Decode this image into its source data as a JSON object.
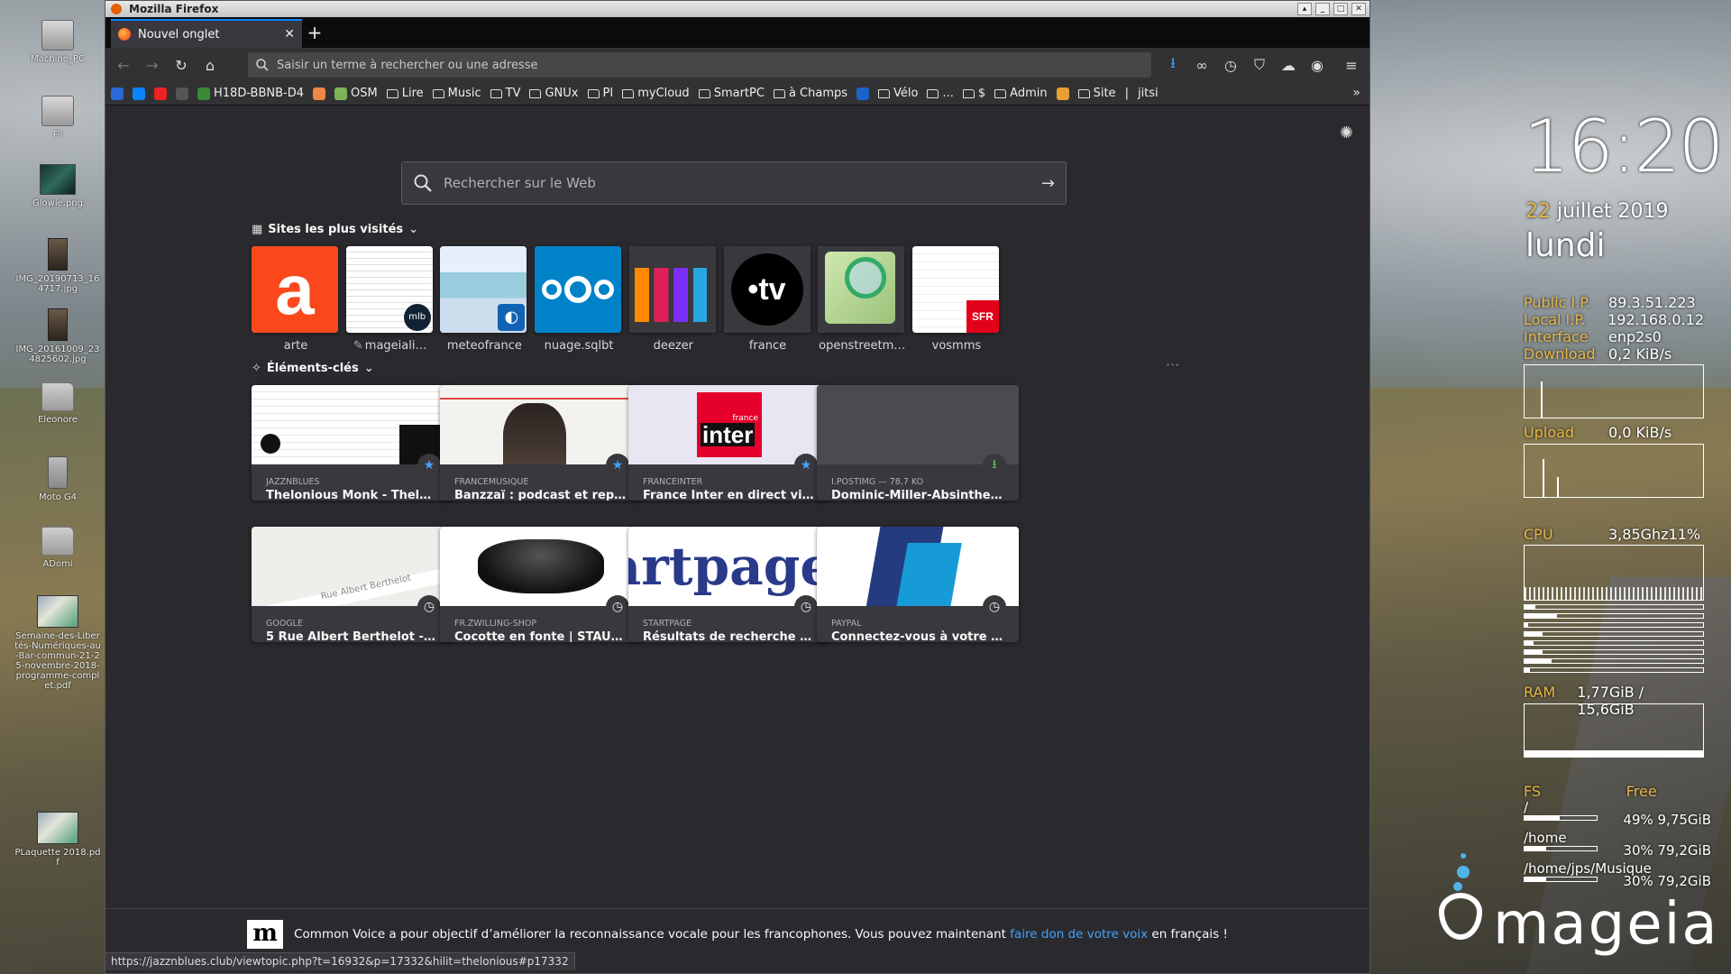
{
  "desktop": {
    "icons": [
      {
        "label": "Machine_PC",
        "kind": "drive"
      },
      {
        "label": "Fil",
        "kind": "drive"
      },
      {
        "label": "Glowie.png",
        "kind": "img"
      },
      {
        "label": "IMG_20190713_164717.jpg",
        "kind": "photo"
      },
      {
        "label": "IMG_20161009_234825602.jpg",
        "kind": "photo"
      },
      {
        "label": "Eleonore",
        "kind": "folder"
      },
      {
        "label": "Moto G4",
        "kind": "phone"
      },
      {
        "label": "ADomi",
        "kind": "folder"
      },
      {
        "label": "Semaine-des-Libertés-Numériques-au-Bar-commun-21-25-novembre-2018-programme-complet.pdf",
        "kind": "pdf"
      },
      {
        "label": "PLaquette 2018.pdf",
        "kind": "pdf"
      }
    ]
  },
  "window": {
    "title": "Mozilla Firefox"
  },
  "tabs": [
    {
      "label": "Nouvel onglet",
      "close": "✕"
    }
  ],
  "newtab_label": "+",
  "navbar": {
    "url_placeholder": "Saisir un terme à rechercher ou une adresse"
  },
  "bookmarks": [
    {
      "label": "",
      "kind": "fav",
      "color": "#2a6ad8"
    },
    {
      "label": "",
      "kind": "fav",
      "color": "#0a84ff"
    },
    {
      "label": "",
      "kind": "fav",
      "color": "#e22"
    },
    {
      "label": "",
      "kind": "fav",
      "color": "#555"
    },
    {
      "label": "H18D-BBNB-D4",
      "kind": "fav",
      "color": "#3a8a3a"
    },
    {
      "label": "",
      "kind": "fav",
      "color": "#e84"
    },
    {
      "label": "OSM",
      "kind": "fav",
      "color": "#7eb35a"
    },
    {
      "label": "Lire",
      "kind": "folder"
    },
    {
      "label": "Music",
      "kind": "folder"
    },
    {
      "label": "TV",
      "kind": "folder"
    },
    {
      "label": "GNUx",
      "kind": "folder"
    },
    {
      "label": "PI",
      "kind": "folder"
    },
    {
      "label": "myCloud",
      "kind": "folder"
    },
    {
      "label": "SmartPC",
      "kind": "folder"
    },
    {
      "label": "à Champs",
      "kind": "folder"
    },
    {
      "label": "",
      "kind": "fav",
      "color": "#1a64c8"
    },
    {
      "label": "Vélo",
      "kind": "folder"
    },
    {
      "label": "...",
      "kind": "folder"
    },
    {
      "label": "$",
      "kind": "folder"
    },
    {
      "label": "Admin",
      "kind": "folder"
    },
    {
      "label": "",
      "kind": "fav",
      "color": "#e8a030"
    },
    {
      "label": "Site",
      "kind": "folder"
    },
    {
      "label": "|",
      "kind": "text"
    },
    {
      "label": "jitsi",
      "kind": "text"
    }
  ],
  "newtab": {
    "search_placeholder": "Rechercher sur le Web",
    "top_sites_title": "Sites les plus visités",
    "highlights_title": "Éléments-clés",
    "top_sites": [
      {
        "name": "arte"
      },
      {
        "name": "mageiali…",
        "pinned": true
      },
      {
        "name": "meteofrance"
      },
      {
        "name": "nuage.sqlbt"
      },
      {
        "name": "deezer"
      },
      {
        "name": "france"
      },
      {
        "name": "openstreetm…"
      },
      {
        "name": "vosmms"
      }
    ],
    "highlights": [
      {
        "source": "JAZZNBLUES",
        "title": "Thelonious Monk - Thelonio…",
        "badge": "bookmark"
      },
      {
        "source": "FRANCEMUSIQUE",
        "title": "Banzzaï : podcast et replay …",
        "badge": "bookmark"
      },
      {
        "source": "FRANCEINTER",
        "title": "France Inter en direct vidéo…",
        "badge": "bookmark"
      },
      {
        "source": "I.POSTIMG — 78,7 KO",
        "title": "Dominic-Miller-Absinthe-20…",
        "badge": "download"
      },
      {
        "source": "GOOGLE",
        "title": "5 Rue Albert Berthelot - Go…",
        "badge": "history"
      },
      {
        "source": "FR.ZWILLING-SHOP",
        "title": "Cocotte en fonte | STAUB | o…",
        "badge": "history"
      },
      {
        "source": "STARTPAGE",
        "title": "Résultats de recherche - St…",
        "badge": "history"
      },
      {
        "source": "PAYPAL",
        "title": "Connectez-vous à votre com…",
        "badge": "history"
      }
    ],
    "thumb_texts": {
      "inter_small": "france",
      "inter_big": "inter",
      "tv": "•tv",
      "sfr": "SFR",
      "mlb": "mlb",
      "startpage": "artpage.",
      "map_street": "Rue Albert Berthelot"
    },
    "snippet": {
      "logo": "m",
      "text_before": "Common Voice a pour objectif d’améliorer la reconnaissance vocale pour les francophones. Vous pouvez maintenant ",
      "link": "faire don de votre voix",
      "text_after": " en français !"
    }
  },
  "status_url": "https://jazznblues.club/viewtopic.php?t=16932&p=17332&hilit=thelonious#p17332",
  "conky": {
    "time": "16:20",
    "date_day": "22",
    "date_rest": " juillet 2019",
    "weekday": "lundi",
    "public_ip_label": "Public I.P.",
    "public_ip": "89.3.51.223",
    "local_ip_label": "Local I.P.",
    "local_ip": "192.168.0.12",
    "interface_label": "Interface",
    "interface": "enp2s0",
    "download_label": "Download",
    "download": "0,2 KiB/s",
    "upload_label": "Upload",
    "upload": "0,0 KiB/s",
    "cpu_label": "CPU",
    "cpu": "3,85Ghz11%",
    "cpu_cores": [
      0.06,
      0.18,
      0.02,
      0.1,
      0.05,
      0.1,
      0.15,
      0.03
    ],
    "ram_label": "RAM",
    "ram": "1,77GiB / 15,6GiB",
    "ram_fraction": 0.11,
    "fs_label": "FS",
    "free_label": "Free",
    "fs": [
      {
        "mount": "/",
        "used_pct": 0.49,
        "text": "49% 9,75GiB"
      },
      {
        "mount": "/home",
        "used_pct": 0.3,
        "text": "30% 79,2GiB"
      },
      {
        "mount": "/home/jps/Musique",
        "used_pct": 0.3,
        "text": "30% 79,2GiB"
      }
    ],
    "brand": "mageia"
  },
  "colors": {
    "accent": "#0a84ff",
    "conky_label": "#e8b64a",
    "arte": "#fa481c",
    "nextcloud": "#0082c9",
    "sfr": "#e2001a"
  }
}
